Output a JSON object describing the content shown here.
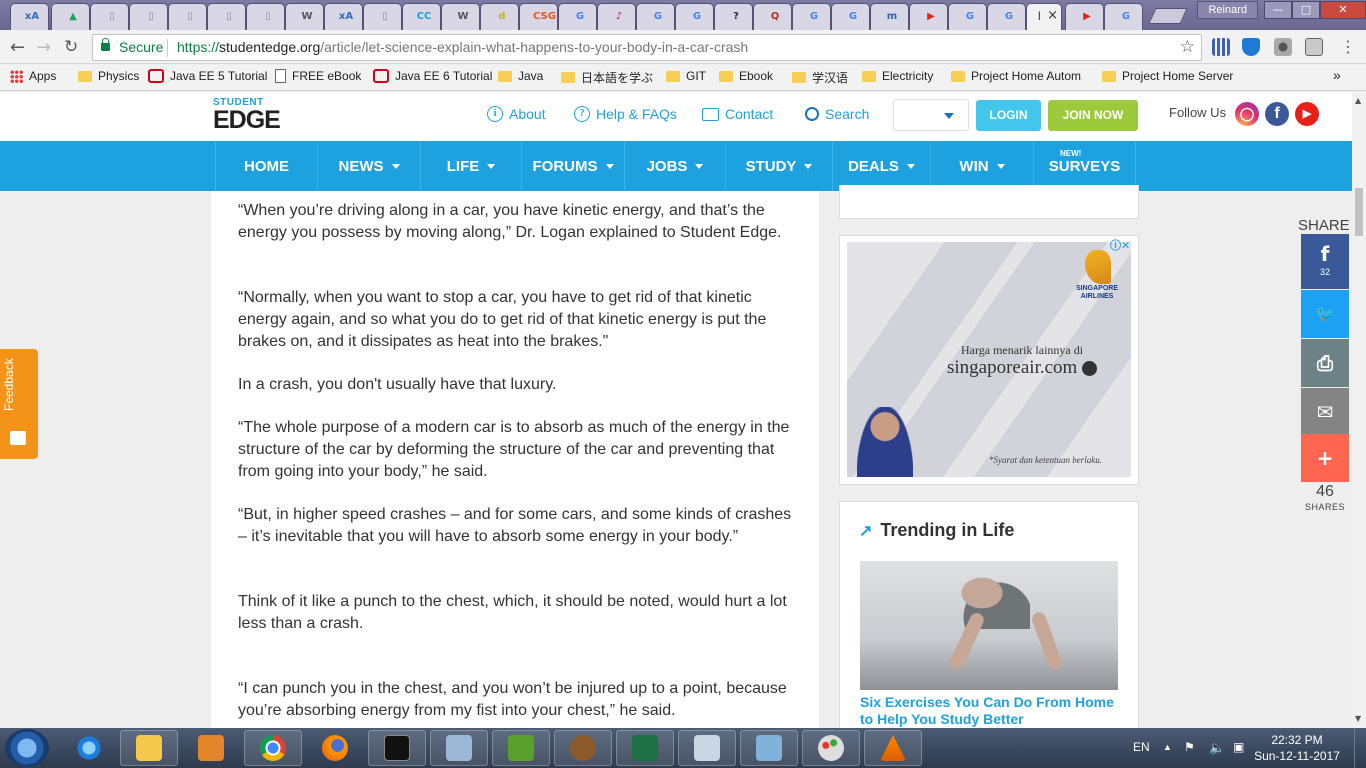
{
  "browser": {
    "profile": "Reinard",
    "url_prefix": "https://",
    "url_domain": "studentedge.org",
    "url_path": "/article/let-science-explain-what-happens-to-your-body-in-a-car-crash",
    "secure_label": "Secure",
    "active_tab_label": "l",
    "tab_favicons": [
      {
        "glyph": "xA",
        "color": "#2f6bc0"
      },
      {
        "glyph": "▲",
        "color": "#1fa463"
      },
      {
        "glyph": "▯",
        "color": "#8e8e8e"
      },
      {
        "glyph": "▯",
        "color": "#8e8e8e"
      },
      {
        "glyph": "▯",
        "color": "#8e8e8e"
      },
      {
        "glyph": "▯",
        "color": "#8e8e8e"
      },
      {
        "glyph": "▯",
        "color": "#8e8e8e"
      },
      {
        "glyph": "W",
        "color": "#555555"
      },
      {
        "glyph": "xA",
        "color": "#2f6bc0"
      },
      {
        "glyph": "▯",
        "color": "#8e8e8e"
      },
      {
        "glyph": "CC",
        "color": "#1a9fd6"
      },
      {
        "glyph": "W",
        "color": "#555555"
      },
      {
        "glyph": "d",
        "color": "#c5b31a"
      },
      {
        "glyph": "CSG",
        "color": "#e35a1b"
      },
      {
        "glyph": "G",
        "color": "#4285f4"
      },
      {
        "glyph": "♪",
        "color": "#c2185b"
      },
      {
        "glyph": "G",
        "color": "#4285f4"
      },
      {
        "glyph": "G",
        "color": "#4285f4"
      },
      {
        "glyph": "?",
        "color": "#1e2a5a"
      },
      {
        "glyph": "Q",
        "color": "#b92b27"
      },
      {
        "glyph": "G",
        "color": "#4285f4"
      },
      {
        "glyph": "G",
        "color": "#4285f4"
      },
      {
        "glyph": "m",
        "color": "#2d64b3"
      },
      {
        "glyph": "▶",
        "color": "#e62117"
      },
      {
        "glyph": "G",
        "color": "#4285f4"
      },
      {
        "glyph": "G",
        "color": "#4285f4"
      }
    ],
    "after_tabs": [
      {
        "glyph": "▶",
        "color": "#e62117"
      },
      {
        "glyph": "G",
        "color": "#4285f4"
      }
    ]
  },
  "bookmarks": [
    {
      "label": "Apps",
      "icon": "apps-grid-icon"
    },
    {
      "label": "Physics",
      "icon": "folder-icon"
    },
    {
      "label": "Java EE 5 Tutorial",
      "icon": "oracle-icon"
    },
    {
      "label": "FREE eBook",
      "icon": "page-icon"
    },
    {
      "label": "Java EE 6 Tutorial",
      "icon": "oracle-icon"
    },
    {
      "label": "Java",
      "icon": "folder-icon"
    },
    {
      "label": "日本語を学ぶ",
      "icon": "folder-icon"
    },
    {
      "label": "GIT",
      "icon": "folder-icon"
    },
    {
      "label": "Ebook",
      "icon": "folder-icon"
    },
    {
      "label": "学汉语",
      "icon": "folder-icon"
    },
    {
      "label": "Electricity",
      "icon": "folder-icon"
    },
    {
      "label": "Project Home Autom",
      "icon": "folder-icon"
    },
    {
      "label": "Project Home Server",
      "icon": "folder-icon"
    }
  ],
  "bookmarks_overflow": "»",
  "site": {
    "logo_top": "STUDENT",
    "logo_main": "EDGE",
    "links": {
      "about": "About",
      "help": "Help & FAQs",
      "contact": "Contact",
      "search": "Search"
    },
    "login": "LOGIN",
    "join": "JOIN NOW",
    "follow": "Follow Us",
    "nav": [
      {
        "label": "HOME",
        "dropdown": false
      },
      {
        "label": "NEWS",
        "dropdown": true
      },
      {
        "label": "LIFE",
        "dropdown": true
      },
      {
        "label": "FORUMS",
        "dropdown": true
      },
      {
        "label": "JOBS",
        "dropdown": true
      },
      {
        "label": "STUDY",
        "dropdown": true
      },
      {
        "label": "DEALS",
        "dropdown": true
      },
      {
        "label": "WIN",
        "dropdown": true
      },
      {
        "label": "SURVEYS",
        "dropdown": false
      }
    ],
    "nav_new_tag": "NEW!"
  },
  "article": {
    "paragraphs": [
      "“When you’re driving along in a car, you have kinetic energy, and that’s the energy you possess by moving along,” Dr. Logan explained to Student Edge.",
      "“Normally, when you want to stop a car, you have to get rid of that kinetic energy again, and so what you do to get rid of that kinetic energy is put the brakes on, and it dissipates as heat into the brakes.\"",
      "In a crash, you don't usually have that luxury.",
      "“The whole purpose of a modern car is to absorb as much of the energy in the structure of the car by deforming the structure of the car and preventing that from going into your body,” he said.",
      "“But, in higher speed crashes – and for some cars, and some kinds of crashes – it’s inevitable that you will have to absorb some energy in your body.”",
      "Think of it like a punch to the chest, which, it should be noted, would hurt a lot less than a crash.",
      "“I can punch you in the chest, and you won’t be injured up to a point, because you’re absorbing energy from my fist into your chest,” he said."
    ]
  },
  "ad": {
    "brand_line1": "SINGAPORE",
    "brand_line2": "AIRLINES",
    "line1": "Harga menarik lainnya di",
    "line2": "singaporeair.com",
    "footnote": "*Syarat dan ketentuan berlaku."
  },
  "trending": {
    "title": "Trending in Life",
    "link": "Six Exercises You Can Do From Home to Help You Study Better"
  },
  "share": {
    "label": "SHARE",
    "facebook_count": "32",
    "total": "46",
    "total_label": "SHARES",
    "colors": {
      "facebook": "#3b5998",
      "twitter": "#1da1f2",
      "print": "#6d8286",
      "email": "#848484",
      "more": "#ff6550"
    }
  },
  "feedback": "Feedback",
  "taskbar": {
    "lang": "EN",
    "time": "22:32 PM",
    "date": "Sun-12-11-2017"
  }
}
